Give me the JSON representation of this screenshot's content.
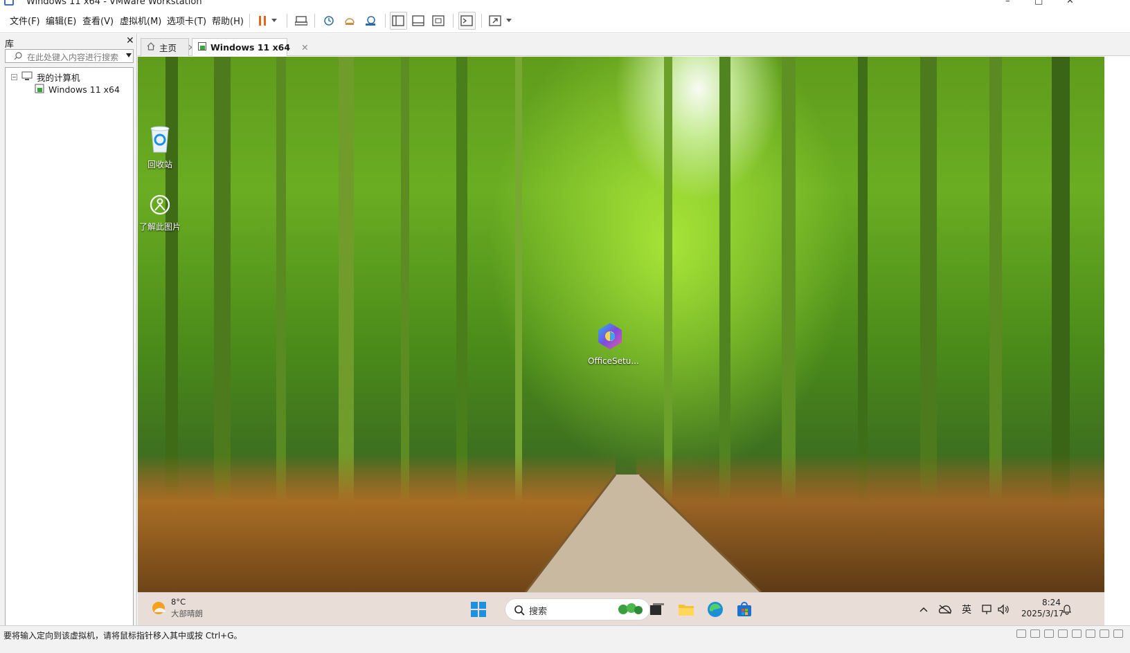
{
  "window": {
    "title": "Windows 11 x64 - VMware Workstation",
    "controls": [
      "–",
      "□",
      "✕"
    ]
  },
  "menu": {
    "items": [
      "文件(F)",
      "编辑(E)",
      "查看(V)",
      "虚拟机(M)",
      "选项卡(T)",
      "帮助(H)"
    ]
  },
  "toolbar": {
    "icons": [
      "pause-icon",
      "dropdown-icon",
      "send-ctrl-alt-del-icon",
      "snapshot-icon",
      "restore-snapshot-icon",
      "snapshot-manager-icon",
      "library-view-icon",
      "thumbnail-view-icon",
      "fullscreen-icon",
      "console-icon",
      "unity-icon",
      "unity-dropdown-icon"
    ]
  },
  "library": {
    "title": "库",
    "close": "✕",
    "search_placeholder": "在此处键入内容进行搜索",
    "tree": {
      "root": "我的计算机",
      "children": [
        "Windows 11 x64"
      ]
    }
  },
  "tabs": [
    {
      "label": "主页",
      "close": "✕",
      "active": false
    },
    {
      "label": "Windows 11 x64",
      "close": "✕",
      "active": true
    }
  ],
  "desktop": {
    "icons": [
      {
        "label": "回收站",
        "icon": "recycle-bin-icon"
      },
      {
        "label": "了解此图片",
        "icon": "learn-picture-icon"
      },
      {
        "label": "OfficeSetu...",
        "icon": "office-setup-icon"
      }
    ]
  },
  "taskbar": {
    "weather": {
      "temp": "8°C",
      "condition": "大部晴朗"
    },
    "search_label": "搜索",
    "apps": [
      "start-icon",
      "task-view-icon",
      "file-explorer-icon",
      "edge-icon",
      "store-icon"
    ],
    "tray": {
      "ime": "英",
      "time": "8:24",
      "date": "2025/3/17"
    }
  },
  "status": {
    "message": "要将输入定向到该虚拟机，请将鼠标指针移入其中或按 Ctrl+G。"
  },
  "colors": {
    "pause_accent": "#e8641b",
    "taskbar_bg": "#e9ddd8",
    "bamboo_green": "#5f9c1c"
  }
}
